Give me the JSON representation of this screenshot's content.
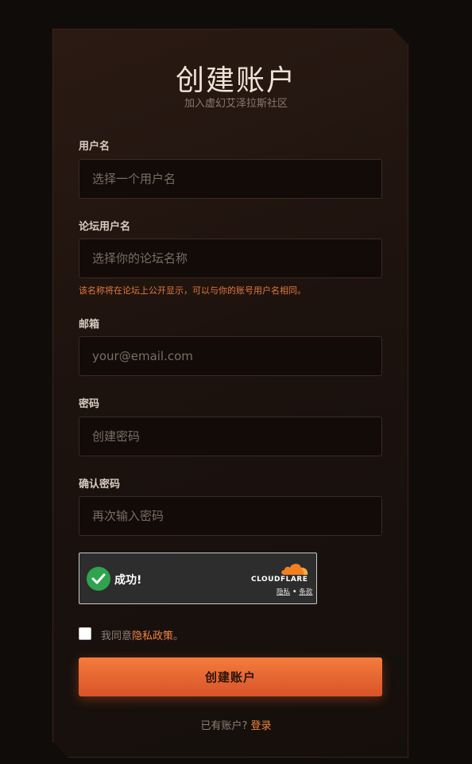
{
  "header": {
    "title": "创建账户",
    "subtitle": "加入虚幻艾泽拉斯社区"
  },
  "form": {
    "username": {
      "label": "用户名",
      "placeholder": "选择一个用户名",
      "value": ""
    },
    "forum_username": {
      "label": "论坛用户名",
      "placeholder": "选择你的论坛名称",
      "value": "",
      "hint": "该名称将在论坛上公开显示，可以与你的账号用户名相同。"
    },
    "email": {
      "label": "邮箱",
      "placeholder": "your@email.com",
      "value": ""
    },
    "password": {
      "label": "密码",
      "placeholder": "创建密码",
      "value": ""
    },
    "confirm_password": {
      "label": "确认密码",
      "placeholder": "再次输入密码",
      "value": ""
    }
  },
  "captcha": {
    "status": "成功!",
    "brand": "CLOUDFLARE",
    "privacy_link": "隐私",
    "separator": " • ",
    "terms_link": "条款"
  },
  "agreement": {
    "prefix": "我同意",
    "link": "隐私政策",
    "suffix": "。",
    "checked": false
  },
  "submit_label": "创建账户",
  "footer": {
    "prompt": "已有账户? ",
    "login_link": "登录"
  },
  "colors": {
    "accent": "#f08544",
    "button_top": "#f47c3c",
    "button_bottom": "#d9532a",
    "success": "#2ea44f",
    "cloudflare_orange": "#f38020"
  },
  "icons": {
    "captcha_check": "check-circle-icon",
    "cloudflare": "cloudflare-cloud-icon"
  }
}
